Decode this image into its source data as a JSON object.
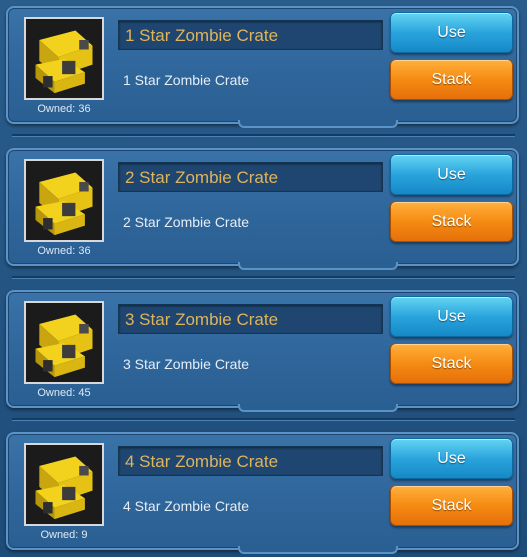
{
  "owned_label": "Owned:",
  "buttons": {
    "use": "Use",
    "stack": "Stack"
  },
  "colors": {
    "panel": "#2f669b",
    "title_text": "#e0b45a",
    "use_button": "#2aa4dd",
    "stack_button": "#f68b12"
  },
  "items": [
    {
      "name": "1 Star Zombie Crate",
      "description": "1 Star Zombie Crate",
      "owned": "36",
      "icon": "crate-icon"
    },
    {
      "name": "2 Star Zombie Crate",
      "description": "2 Star Zombie Crate",
      "owned": "36",
      "icon": "crate-icon"
    },
    {
      "name": "3 Star Zombie Crate",
      "description": "3 Star Zombie Crate",
      "owned": "45",
      "icon": "crate-icon"
    },
    {
      "name": "4 Star Zombie Crate",
      "description": "4 Star Zombie Crate",
      "owned": "9",
      "icon": "crate-icon"
    }
  ]
}
